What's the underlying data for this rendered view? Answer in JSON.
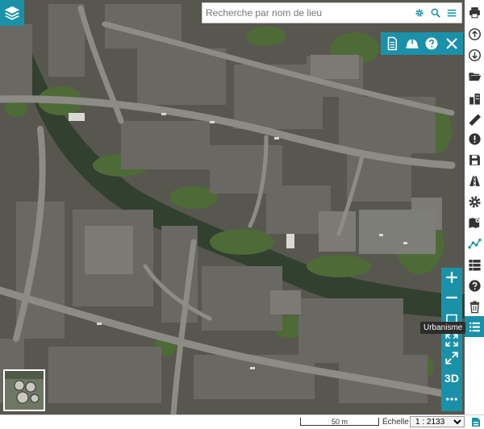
{
  "search": {
    "placeholder": "Recherche par nom de lieu"
  },
  "tooltip": {
    "text": "Urbanisme"
  },
  "nav": {
    "three_d_label": "3D"
  },
  "scale": {
    "bar_label": "50 m",
    "echelle_label": "Échelle :",
    "ratio": "1 : 2133"
  },
  "colors": {
    "accent": "#1a91a8",
    "river": "#32402f",
    "street": "#8c8b85",
    "roof": "#5f5d59"
  },
  "icons": {
    "top_left": "layers-icon",
    "search_bar": [
      "gear-icon",
      "search-icon",
      "menu-icon"
    ],
    "action_toolbar": [
      "document-icon",
      "helmet-icon",
      "help-icon",
      "close-icon"
    ],
    "sidebar": [
      "print-icon",
      "upload-icon",
      "download-icon",
      "folder-open-icon",
      "buildings-icon",
      "ruler-icon",
      "alert-icon",
      "save-icon",
      "road-icon",
      "settings-icon",
      "map-book-icon",
      "route-icon",
      "grid-icon",
      "help-icon",
      "trash-icon",
      "list-icon"
    ],
    "nav_column": [
      "zoom-in-icon",
      "zoom-out-icon",
      "square-icon",
      "fullscreen-icon",
      "expand-icon",
      "3d-button",
      "more-icon"
    ]
  }
}
